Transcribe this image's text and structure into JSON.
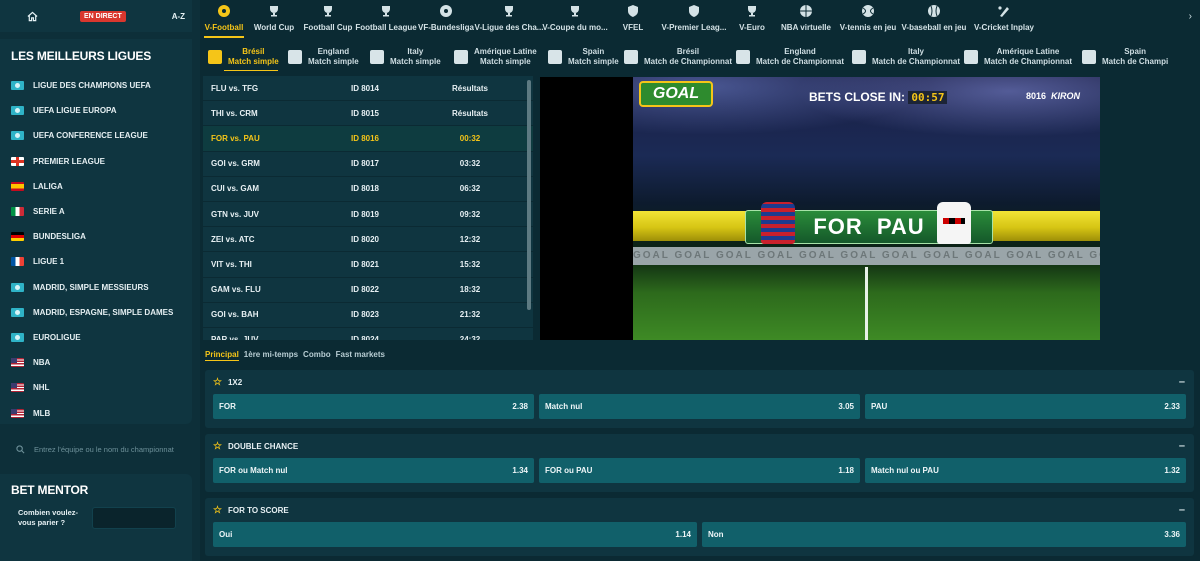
{
  "topnav": {
    "direct_label": "EN DIRECT",
    "az_label": "A-Z"
  },
  "sidebar": {
    "title": "LES MEILLEURS LIGUES",
    "leagues": [
      {
        "label": "LIGUE DES CHAMPIONS UEFA",
        "flag": "globe"
      },
      {
        "label": "UEFA LIGUE EUROPA",
        "flag": "globe"
      },
      {
        "label": "UEFA CONFERENCE LEAGUE",
        "flag": "globe"
      },
      {
        "label": "PREMIER LEAGUE",
        "flag": "eng"
      },
      {
        "label": "LALIGA",
        "flag": "esp"
      },
      {
        "label": "SERIE A",
        "flag": "ita"
      },
      {
        "label": "BUNDESLIGA",
        "flag": "ger"
      },
      {
        "label": "LIGUE 1",
        "flag": "fra"
      },
      {
        "label": "MADRID, SIMPLE MESSIEURS",
        "flag": "globe"
      },
      {
        "label": "MADRID, ESPAGNE, SIMPLE DAMES",
        "flag": "globe"
      },
      {
        "label": "EUROLIGUE",
        "flag": "globe"
      },
      {
        "label": "NBA",
        "flag": "usa"
      },
      {
        "label": "NHL",
        "flag": "usa"
      },
      {
        "label": "MLB",
        "flag": "usa"
      }
    ],
    "search_placeholder": "Entrez l'équipe ou le nom du championnat",
    "mentor_title": "BET MENTOR",
    "mentor_question": "Combien voulez-vous parier ?"
  },
  "sports": [
    {
      "label": "V-Football",
      "icon": "football-icon",
      "active": true
    },
    {
      "label": "World Cup",
      "icon": "trophy-icon"
    },
    {
      "label": "Football Cup",
      "icon": "trophy-icon"
    },
    {
      "label": "Football League",
      "icon": "trophy-icon"
    },
    {
      "label": "VF-Bundesliga",
      "icon": "football-icon"
    },
    {
      "label": "V-Ligue des Cha...",
      "icon": "trophy-icon"
    },
    {
      "label": "V-Coupe du mo...",
      "icon": "trophy-icon"
    },
    {
      "label": "VFEL",
      "icon": "shield-icon"
    },
    {
      "label": "V-Premier Leag...",
      "icon": "shield-icon"
    },
    {
      "label": "V-Euro",
      "icon": "trophy-icon"
    },
    {
      "label": "NBA virtuelle",
      "icon": "basketball-icon"
    },
    {
      "label": "V-tennis en jeu",
      "icon": "tennis-icon"
    },
    {
      "label": "V-baseball en jeu",
      "icon": "baseball-icon"
    },
    {
      "label": "V-Cricket Inplay",
      "icon": "cricket-icon"
    }
  ],
  "comps": [
    {
      "country": "Brésil",
      "type": "Match simple",
      "active": true
    },
    {
      "country": "England",
      "type": "Match simple"
    },
    {
      "country": "Italy",
      "type": "Match simple"
    },
    {
      "country": "Amérique Latine",
      "type": "Match simple"
    },
    {
      "country": "Spain",
      "type": "Match simple"
    },
    {
      "country": "Brésil",
      "type": "Match de Championnat"
    },
    {
      "country": "England",
      "type": "Match de Championnat"
    },
    {
      "country": "Italy",
      "type": "Match de Championnat"
    },
    {
      "country": "Amérique Latine",
      "type": "Match de Championnat"
    },
    {
      "country": "Spain",
      "type": "Match de Champi"
    }
  ],
  "matches": [
    {
      "teams": "FLU vs. TFG",
      "id": "ID 8014",
      "time": "Résultats"
    },
    {
      "teams": "THI vs. CRM",
      "id": "ID 8015",
      "time": "Résultats"
    },
    {
      "teams": "FOR vs. PAU",
      "id": "ID 8016",
      "time": "00:32",
      "active": true
    },
    {
      "teams": "GOI vs. GRM",
      "id": "ID 8017",
      "time": "03:32"
    },
    {
      "teams": "CUI vs. GAM",
      "id": "ID 8018",
      "time": "06:32"
    },
    {
      "teams": "GTN vs. JUV",
      "id": "ID 8019",
      "time": "09:32"
    },
    {
      "teams": "ZEI vs. ATC",
      "id": "ID 8020",
      "time": "12:32"
    },
    {
      "teams": "VIT vs. THI",
      "id": "ID 8021",
      "time": "15:32"
    },
    {
      "teams": "GAM vs. FLU",
      "id": "ID 8022",
      "time": "18:32"
    },
    {
      "teams": "GOI vs. BAH",
      "id": "ID 8023",
      "time": "21:32"
    },
    {
      "teams": "PAR vs. JUV",
      "id": "ID 8024",
      "time": "24:32"
    }
  ],
  "video": {
    "logo": "GOAL",
    "bets_close_label": "BETS CLOSE IN:",
    "countdown": "00:57",
    "match_id": "8016",
    "provider": "KIRON",
    "team_home": "FOR",
    "team_away": "PAU",
    "board_text": "GOAL  GOAL  GOAL  GOAL  GOAL  GOAL  GOAL  GOAL  GOAL  GOAL  GOAL  GOAL  GOAL  GOAL  GOAL  GOAL  GOAL"
  },
  "market_tabs": [
    "Principal",
    "1ère mi-temps",
    "Combo",
    "Fast markets"
  ],
  "markets": [
    {
      "title": "1X2",
      "odds": [
        {
          "label": "FOR",
          "value": "2.38"
        },
        {
          "label": "Match nul",
          "value": "3.05"
        },
        {
          "label": "PAU",
          "value": "2.33"
        }
      ]
    },
    {
      "title": "DOUBLE CHANCE",
      "odds": [
        {
          "label": "FOR ou Match nul",
          "value": "1.34"
        },
        {
          "label": "FOR ou PAU",
          "value": "1.18"
        },
        {
          "label": "Match nul ou PAU",
          "value": "1.32"
        }
      ]
    },
    {
      "title": "FOR TO SCORE",
      "odds": [
        {
          "label": "Oui",
          "value": "1.14"
        },
        {
          "label": "Non",
          "value": "3.36"
        }
      ]
    }
  ],
  "colors": {
    "accent": "#f5c518",
    "background": "#0b2a33",
    "panel": "#0f3540",
    "odds_button": "#11606a",
    "live_badge": "#d9372e"
  }
}
